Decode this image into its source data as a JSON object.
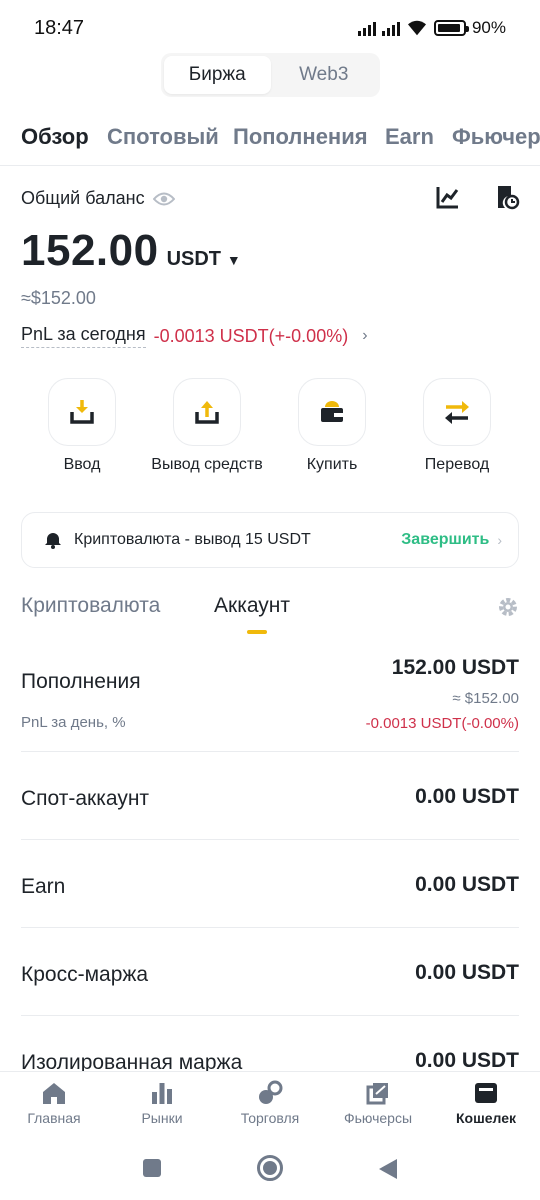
{
  "status_bar": {
    "time": "18:47",
    "battery": "90%",
    "battery_level": 0.9
  },
  "segmented": {
    "items": [
      "Биржа",
      "Web3"
    ],
    "selected": "Биржа"
  },
  "tabs": [
    "Обзор",
    "Спотовый",
    "Пополнения",
    "Earn",
    "Фьючер"
  ],
  "balance": {
    "label": "Общий баланс",
    "value": "152.00",
    "unit": "USDT",
    "usd": "≈$152.00",
    "pnl_label": "PnL за сегодня",
    "pnl_value": "-0.0013 USDT(+-0.00%)"
  },
  "actions": [
    {
      "label": "Ввод",
      "icon": "deposit-icon"
    },
    {
      "label": "Вывод средств",
      "icon": "withdraw-icon"
    },
    {
      "label": "Купить",
      "icon": "wallet-buy-icon"
    },
    {
      "label": "Перевод",
      "icon": "transfer-icon"
    }
  ],
  "notice": {
    "text": "Криптовалюта - вывод 15 USDT",
    "action": "Завершить",
    "icon": "bell-icon"
  },
  "sub_tabs": {
    "items": [
      "Криптовалюта",
      "Аккаунт"
    ],
    "selected": "Аккаунт"
  },
  "accounts": [
    {
      "name": "Пополнения",
      "value": "152.00 USDT",
      "usd": "≈ $152.00",
      "sub_label": "PnL за день, %",
      "pnl": "-0.0013 USDT(-0.00%)"
    },
    {
      "name": "Спот-аккаунт",
      "value": "0.00 USDT"
    },
    {
      "name": "Earn",
      "value": "0.00 USDT"
    },
    {
      "name": "Кросс-маржа",
      "value": "0.00 USDT"
    },
    {
      "name": "Изолированная маржа",
      "value": "0.00 USDT"
    }
  ],
  "bottom_nav": [
    {
      "label": "Главная",
      "icon": "home-icon"
    },
    {
      "label": "Рынки",
      "icon": "markets-icon"
    },
    {
      "label": "Торговля",
      "icon": "trade-icon"
    },
    {
      "label": "Фьючерсы",
      "icon": "futures-icon"
    },
    {
      "label": "Кошелек",
      "icon": "wallet-icon",
      "active": true
    }
  ],
  "colors": {
    "accent": "#f0b90b",
    "negative": "#cf304a",
    "positive": "#2ebd85",
    "muted": "#707a8a"
  }
}
